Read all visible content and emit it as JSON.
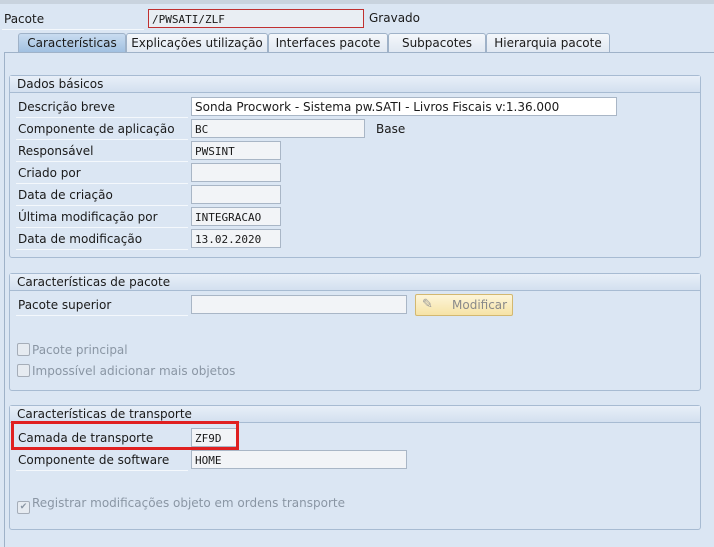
{
  "header": {
    "package_label": "Pacote",
    "package_value": "/PWSATI/ZLF",
    "status": "Gravado"
  },
  "tabs": [
    "Características",
    "Explicações utilização",
    "Interfaces pacote",
    "Subpacotes",
    "Hierarquia pacote"
  ],
  "basic": {
    "title": "Dados básicos",
    "fields": [
      {
        "label": "Descrição breve",
        "value": "Sonda Procwork - Sistema pw.SATI - Livros Fiscais v:1.36.000"
      },
      {
        "label": "Componente de aplicação",
        "value": "BC",
        "extra": "Base"
      },
      {
        "label": "Responsável",
        "value": "PWSINT"
      },
      {
        "label": "Criado por",
        "value": ""
      },
      {
        "label": "Data de criação",
        "value": ""
      },
      {
        "label": "Última modificação por",
        "value": "INTEGRACAO"
      },
      {
        "label": "Data de modificação",
        "value": "13.02.2020"
      }
    ]
  },
  "package": {
    "title": "Características de pacote",
    "superior_label": "Pacote superior",
    "superior_value": "",
    "modify_button": "Modificar",
    "main_package": "Pacote principal",
    "no_more_objects": "Impossível adicionar mais objetos"
  },
  "transport": {
    "title": "Características de transporte",
    "layer_label": "Camada de transporte",
    "layer_value": "ZF9D",
    "software_label": "Componente de software",
    "software_value": "HOME",
    "record_changes": "Registrar modificações objeto em ordens transporte"
  },
  "colors": {
    "highlight": "#e02020"
  }
}
